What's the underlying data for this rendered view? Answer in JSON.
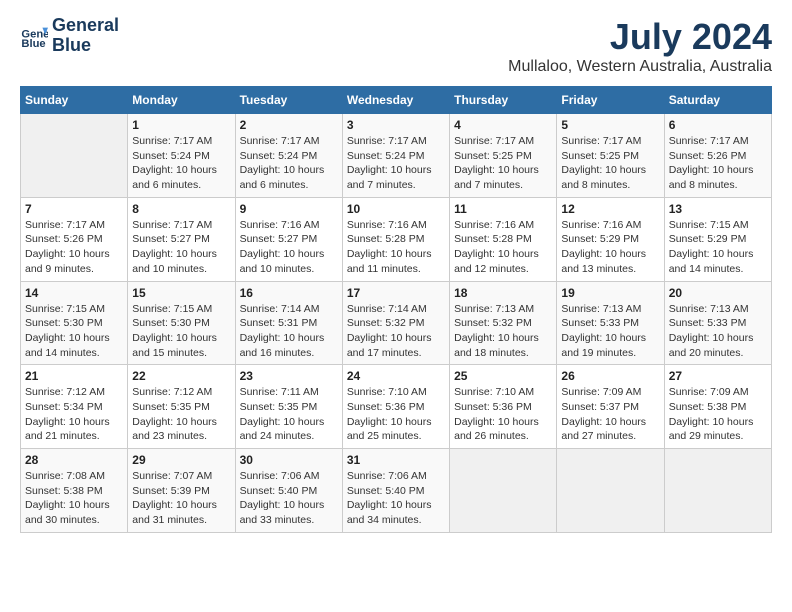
{
  "logo": {
    "line1": "General",
    "line2": "Blue"
  },
  "title": "July 2024",
  "location": "Mullaloo, Western Australia, Australia",
  "days_of_week": [
    "Sunday",
    "Monday",
    "Tuesday",
    "Wednesday",
    "Thursday",
    "Friday",
    "Saturday"
  ],
  "weeks": [
    [
      {
        "day": "",
        "sunrise": "",
        "sunset": "",
        "daylight": ""
      },
      {
        "day": "1",
        "sunrise": "Sunrise: 7:17 AM",
        "sunset": "Sunset: 5:24 PM",
        "daylight": "Daylight: 10 hours and 6 minutes."
      },
      {
        "day": "2",
        "sunrise": "Sunrise: 7:17 AM",
        "sunset": "Sunset: 5:24 PM",
        "daylight": "Daylight: 10 hours and 6 minutes."
      },
      {
        "day": "3",
        "sunrise": "Sunrise: 7:17 AM",
        "sunset": "Sunset: 5:24 PM",
        "daylight": "Daylight: 10 hours and 7 minutes."
      },
      {
        "day": "4",
        "sunrise": "Sunrise: 7:17 AM",
        "sunset": "Sunset: 5:25 PM",
        "daylight": "Daylight: 10 hours and 7 minutes."
      },
      {
        "day": "5",
        "sunrise": "Sunrise: 7:17 AM",
        "sunset": "Sunset: 5:25 PM",
        "daylight": "Daylight: 10 hours and 8 minutes."
      },
      {
        "day": "6",
        "sunrise": "Sunrise: 7:17 AM",
        "sunset": "Sunset: 5:26 PM",
        "daylight": "Daylight: 10 hours and 8 minutes."
      }
    ],
    [
      {
        "day": "7",
        "sunrise": "Sunrise: 7:17 AM",
        "sunset": "Sunset: 5:26 PM",
        "daylight": "Daylight: 10 hours and 9 minutes."
      },
      {
        "day": "8",
        "sunrise": "Sunrise: 7:17 AM",
        "sunset": "Sunset: 5:27 PM",
        "daylight": "Daylight: 10 hours and 10 minutes."
      },
      {
        "day": "9",
        "sunrise": "Sunrise: 7:16 AM",
        "sunset": "Sunset: 5:27 PM",
        "daylight": "Daylight: 10 hours and 10 minutes."
      },
      {
        "day": "10",
        "sunrise": "Sunrise: 7:16 AM",
        "sunset": "Sunset: 5:28 PM",
        "daylight": "Daylight: 10 hours and 11 minutes."
      },
      {
        "day": "11",
        "sunrise": "Sunrise: 7:16 AM",
        "sunset": "Sunset: 5:28 PM",
        "daylight": "Daylight: 10 hours and 12 minutes."
      },
      {
        "day": "12",
        "sunrise": "Sunrise: 7:16 AM",
        "sunset": "Sunset: 5:29 PM",
        "daylight": "Daylight: 10 hours and 13 minutes."
      },
      {
        "day": "13",
        "sunrise": "Sunrise: 7:15 AM",
        "sunset": "Sunset: 5:29 PM",
        "daylight": "Daylight: 10 hours and 14 minutes."
      }
    ],
    [
      {
        "day": "14",
        "sunrise": "Sunrise: 7:15 AM",
        "sunset": "Sunset: 5:30 PM",
        "daylight": "Daylight: 10 hours and 14 minutes."
      },
      {
        "day": "15",
        "sunrise": "Sunrise: 7:15 AM",
        "sunset": "Sunset: 5:30 PM",
        "daylight": "Daylight: 10 hours and 15 minutes."
      },
      {
        "day": "16",
        "sunrise": "Sunrise: 7:14 AM",
        "sunset": "Sunset: 5:31 PM",
        "daylight": "Daylight: 10 hours and 16 minutes."
      },
      {
        "day": "17",
        "sunrise": "Sunrise: 7:14 AM",
        "sunset": "Sunset: 5:32 PM",
        "daylight": "Daylight: 10 hours and 17 minutes."
      },
      {
        "day": "18",
        "sunrise": "Sunrise: 7:13 AM",
        "sunset": "Sunset: 5:32 PM",
        "daylight": "Daylight: 10 hours and 18 minutes."
      },
      {
        "day": "19",
        "sunrise": "Sunrise: 7:13 AM",
        "sunset": "Sunset: 5:33 PM",
        "daylight": "Daylight: 10 hours and 19 minutes."
      },
      {
        "day": "20",
        "sunrise": "Sunrise: 7:13 AM",
        "sunset": "Sunset: 5:33 PM",
        "daylight": "Daylight: 10 hours and 20 minutes."
      }
    ],
    [
      {
        "day": "21",
        "sunrise": "Sunrise: 7:12 AM",
        "sunset": "Sunset: 5:34 PM",
        "daylight": "Daylight: 10 hours and 21 minutes."
      },
      {
        "day": "22",
        "sunrise": "Sunrise: 7:12 AM",
        "sunset": "Sunset: 5:35 PM",
        "daylight": "Daylight: 10 hours and 23 minutes."
      },
      {
        "day": "23",
        "sunrise": "Sunrise: 7:11 AM",
        "sunset": "Sunset: 5:35 PM",
        "daylight": "Daylight: 10 hours and 24 minutes."
      },
      {
        "day": "24",
        "sunrise": "Sunrise: 7:10 AM",
        "sunset": "Sunset: 5:36 PM",
        "daylight": "Daylight: 10 hours and 25 minutes."
      },
      {
        "day": "25",
        "sunrise": "Sunrise: 7:10 AM",
        "sunset": "Sunset: 5:36 PM",
        "daylight": "Daylight: 10 hours and 26 minutes."
      },
      {
        "day": "26",
        "sunrise": "Sunrise: 7:09 AM",
        "sunset": "Sunset: 5:37 PM",
        "daylight": "Daylight: 10 hours and 27 minutes."
      },
      {
        "day": "27",
        "sunrise": "Sunrise: 7:09 AM",
        "sunset": "Sunset: 5:38 PM",
        "daylight": "Daylight: 10 hours and 29 minutes."
      }
    ],
    [
      {
        "day": "28",
        "sunrise": "Sunrise: 7:08 AM",
        "sunset": "Sunset: 5:38 PM",
        "daylight": "Daylight: 10 hours and 30 minutes."
      },
      {
        "day": "29",
        "sunrise": "Sunrise: 7:07 AM",
        "sunset": "Sunset: 5:39 PM",
        "daylight": "Daylight: 10 hours and 31 minutes."
      },
      {
        "day": "30",
        "sunrise": "Sunrise: 7:06 AM",
        "sunset": "Sunset: 5:40 PM",
        "daylight": "Daylight: 10 hours and 33 minutes."
      },
      {
        "day": "31",
        "sunrise": "Sunrise: 7:06 AM",
        "sunset": "Sunset: 5:40 PM",
        "daylight": "Daylight: 10 hours and 34 minutes."
      },
      {
        "day": "",
        "sunrise": "",
        "sunset": "",
        "daylight": ""
      },
      {
        "day": "",
        "sunrise": "",
        "sunset": "",
        "daylight": ""
      },
      {
        "day": "",
        "sunrise": "",
        "sunset": "",
        "daylight": ""
      }
    ]
  ]
}
